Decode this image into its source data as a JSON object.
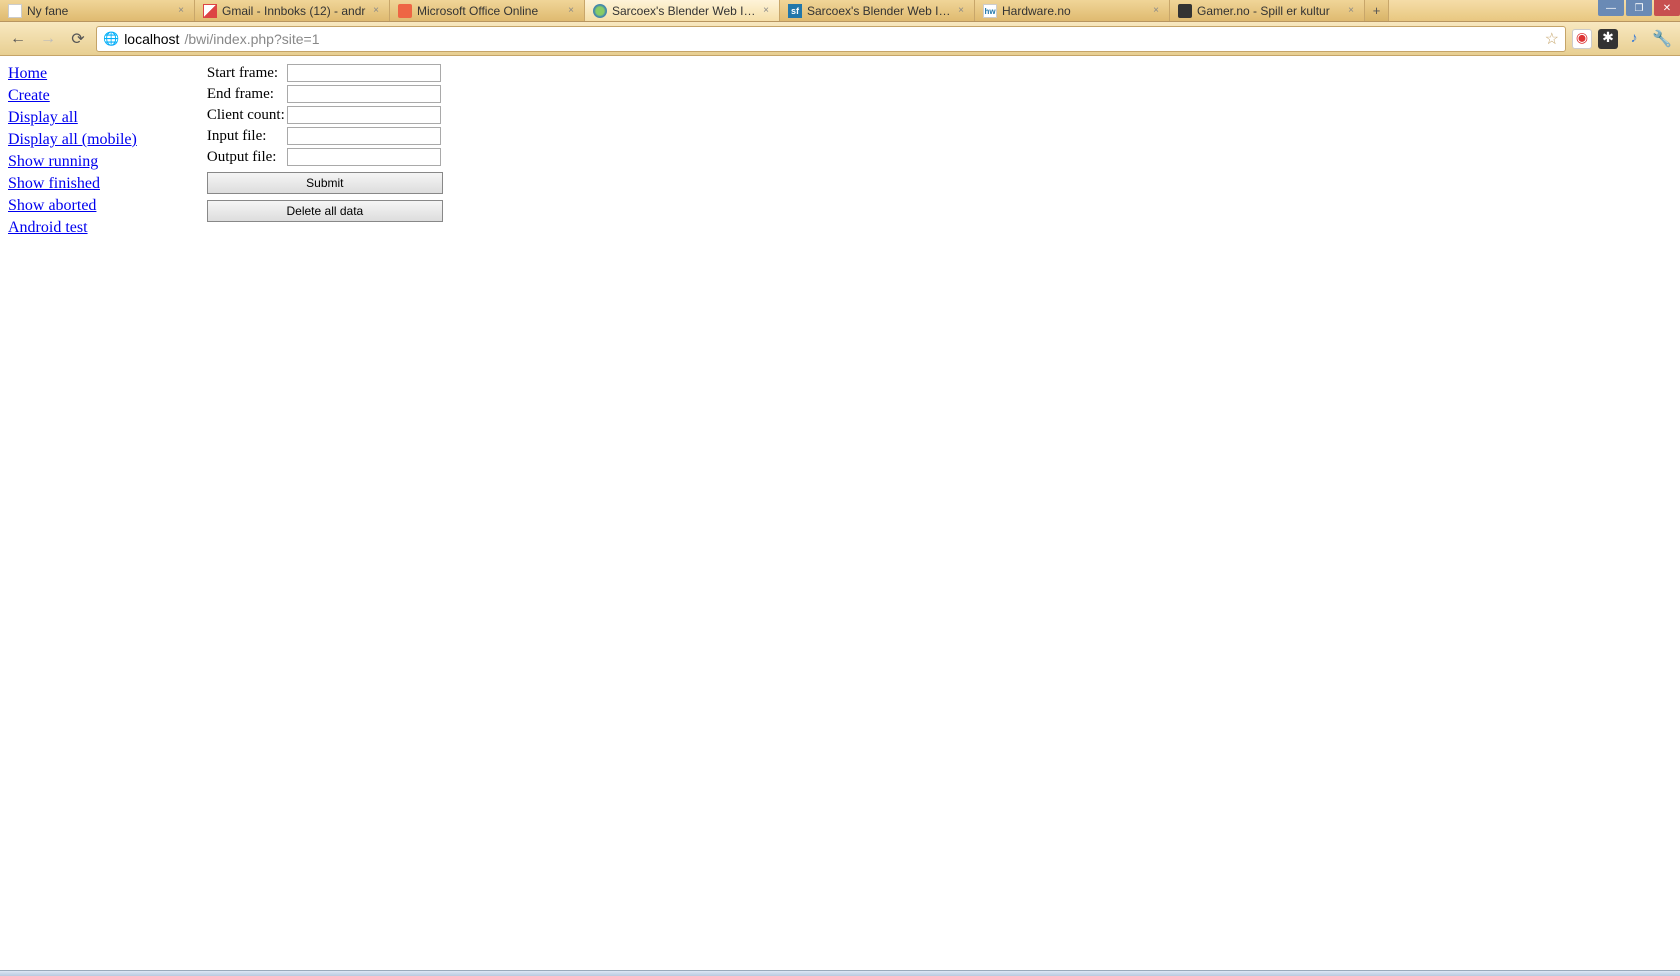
{
  "tabs": [
    {
      "title": "Ny fane",
      "icon": "blank"
    },
    {
      "title": "Gmail - Innboks (12) - andr",
      "icon": "gmail"
    },
    {
      "title": "Microsoft Office Online",
      "icon": "office"
    },
    {
      "title": "Sarcoex's Blender Web Inte",
      "icon": "globe",
      "active": true
    },
    {
      "title": "Sarcoex's Blender Web Inte",
      "icon": "sf"
    },
    {
      "title": "Hardware.no",
      "icon": "hw"
    },
    {
      "title": "Gamer.no - Spill er kultur",
      "icon": "gamer"
    }
  ],
  "newtab_label": "+",
  "win": {
    "min": "—",
    "max": "❐",
    "close": "✕"
  },
  "nav": {
    "back": "←",
    "forward": "→",
    "reload": "⟳"
  },
  "url": {
    "host": "localhost",
    "path": "/bwi/index.php?site=1"
  },
  "star": "☆",
  "ext": {
    "red": "◉",
    "dark": "✱",
    "blue": "♪",
    "wrench": "🔧"
  },
  "sidebar": [
    "Home",
    "Create",
    "Display all",
    "Display all (mobile)",
    "Show running",
    "Show finished",
    "Show aborted",
    "Android test"
  ],
  "form": {
    "start_frame": "Start frame:",
    "end_frame": "End frame:",
    "client_count": "Client count:",
    "input_file": "Input file:",
    "output_file": "Output file:",
    "submit": "Submit",
    "delete": "Delete all data"
  }
}
